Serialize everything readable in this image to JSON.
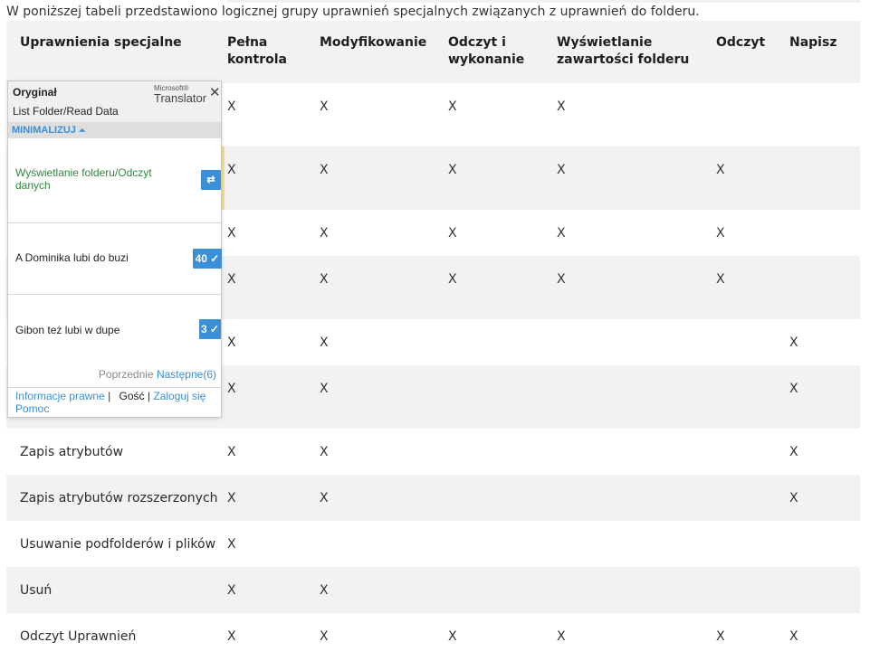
{
  "intro": "W poniższej tabeli przedstawiono logicznej grupy uprawnień specjalnych związanych z uprawnień do folderu.",
  "table": {
    "headers": [
      "Uprawnienia specjalne",
      "Pełna kontrola",
      "Modyfikowanie",
      "Odczyt i wykonanie",
      "Wyświetlanie zawartości folderu",
      "Odczyt",
      "Napisz"
    ],
    "rows": [
      {
        "name": "",
        "cells": [
          "X",
          "X",
          "X",
          "X",
          "",
          ""
        ]
      },
      {
        "name": "",
        "cells": [
          "X",
          "X",
          "X",
          "X",
          "X",
          ""
        ]
      },
      {
        "name": "",
        "cells": [
          "X",
          "X",
          "X",
          "X",
          "X",
          ""
        ]
      },
      {
        "name": "",
        "cells": [
          "X",
          "X",
          "X",
          "X",
          "X",
          ""
        ]
      },
      {
        "name": "",
        "cells": [
          "X",
          "X",
          "",
          "",
          "",
          "X"
        ]
      },
      {
        "name": "",
        "cells": [
          "X",
          "X",
          "",
          "",
          "",
          "X"
        ]
      },
      {
        "name": "Zapis atrybutów",
        "cells": [
          "X",
          "X",
          "",
          "",
          "",
          "X"
        ]
      },
      {
        "name": "Zapis atrybutów rozszerzonych",
        "cells": [
          "X",
          "X",
          "",
          "",
          "",
          "X"
        ]
      },
      {
        "name": "Usuwanie podfolderów i plików",
        "cells": [
          "X",
          "",
          "",
          "",
          "",
          ""
        ]
      },
      {
        "name": "Usuń",
        "cells": [
          "X",
          "X",
          "",
          "",
          "",
          ""
        ]
      },
      {
        "name": "Odczyt Uprawnień",
        "cells": [
          "X",
          "X",
          "X",
          "X",
          "X",
          "X"
        ]
      }
    ]
  },
  "translator": {
    "original_label": "Oryginał",
    "original_text": "List Folder/Read Data",
    "brand_top": "Microsoft®",
    "brand_main": "Translator",
    "close": "✕",
    "minimize_label": "MINIMALIZUJ",
    "minimize_chevron": "⏶",
    "items": [
      {
        "text": "Wyświetlanie folderu/Odczyt danych",
        "badge": "⇄",
        "badge_icon": "translate-icon"
      },
      {
        "text": "A Dominika lubi do buzi",
        "badge": "40 ✓"
      },
      {
        "text": "Gibon też lubi w dupe",
        "badge": "3 ✓"
      }
    ],
    "prev": "Poprzednie",
    "next": "Następne(6)",
    "footer": {
      "legal": "Informacje prawne",
      "guest": "Gość",
      "login": "Zaloguj się",
      "help": "Pomoc"
    },
    "colors": {
      "accent": "#3a8fd6",
      "highlight": "#2c8a3c"
    }
  }
}
